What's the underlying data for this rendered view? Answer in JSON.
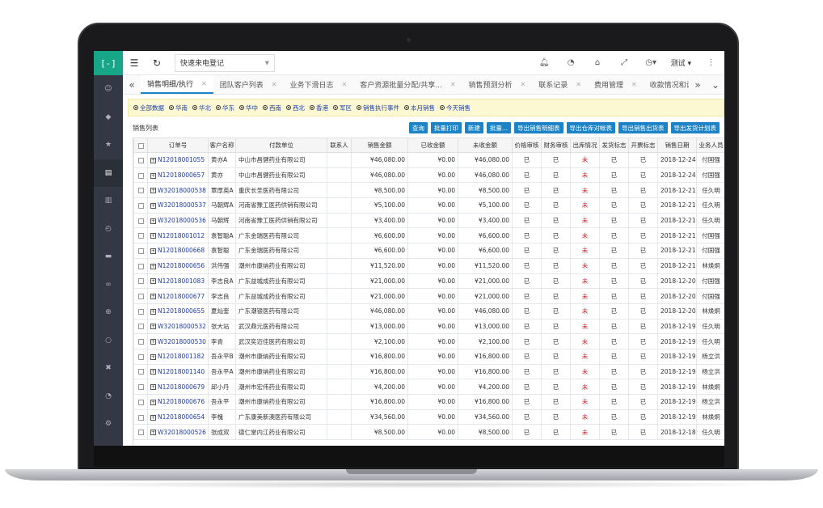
{
  "app": {
    "logo": "[-]",
    "quick_select": "快速来电登记",
    "user": "测试"
  },
  "sidebar": {
    "icons": [
      "user-icon",
      "cube-icon",
      "star-icon",
      "book-icon",
      "chart-icon",
      "clock-icon",
      "message-icon",
      "link-icon",
      "plus-circle-icon",
      "comment-icon",
      "wrench-icon",
      "gauge-icon",
      "settings-icon"
    ],
    "active_index": 3
  },
  "tabs": [
    {
      "label": "销售明细/执行",
      "active": true
    },
    {
      "label": "团队客户列表"
    },
    {
      "label": "业务下滑日志"
    },
    {
      "label": "客户资源批量分配/共享..."
    },
    {
      "label": "销售预测分析"
    },
    {
      "label": "联系记录"
    },
    {
      "label": "费用管理"
    },
    {
      "label": "收款情况和计划"
    }
  ],
  "filters": [
    "全部数据",
    "华南",
    "华北",
    "华东",
    "华中",
    "西南",
    "西北",
    "香港",
    "军区",
    "销售执行事件",
    "本月销售",
    "今天销售"
  ],
  "list_title": "销售列表",
  "actions": [
    "查询",
    "批量打印",
    "新建",
    "批量...",
    "导出销售明细表",
    "导出仓库对帐表",
    "导出销售出货表",
    "导出发货计划表"
  ],
  "columns": [
    "",
    "订单号",
    "客户名称",
    "付款单位",
    "联系人",
    "销售金额",
    "已收金额",
    "未收金额",
    "价格审核",
    "财务审核",
    "出库情况",
    "发货标志",
    "开票标志",
    "销售日期",
    "业务人员"
  ],
  "rows": [
    [
      "N12018001055",
      "黄亦A",
      "中山市昌健药业有限公司",
      "",
      "¥46,080.00",
      "¥0.00",
      "¥46,080.00",
      "已",
      "已",
      "未",
      "已",
      "已",
      "2018-12-24",
      "付国强"
    ],
    [
      "N12018000657",
      "黄亦",
      "中山市昌健药业有限公司",
      "",
      "¥46,080.00",
      "¥0.00",
      "¥46,080.00",
      "已",
      "已",
      "未",
      "已",
      "已",
      "2018-12-24",
      "付国强"
    ],
    [
      "W32018000538",
      "覃厚英A",
      "重庆长圣医药有限公司",
      "",
      "¥8,500.00",
      "¥0.00",
      "¥8,500.00",
      "已",
      "已",
      "未",
      "已",
      "已",
      "2018-12-21",
      "任久明"
    ],
    [
      "W32018000537",
      "马朝辉A",
      "河南省豫工医药供销有限公司",
      "",
      "¥5,100.00",
      "¥0.00",
      "¥5,100.00",
      "已",
      "已",
      "未",
      "已",
      "已",
      "2018-12-21",
      "任久明"
    ],
    [
      "W32018000536",
      "马朝辉",
      "河南省豫工医药供销有限公司",
      "",
      "¥3,400.00",
      "¥0.00",
      "¥3,400.00",
      "已",
      "已",
      "未",
      "已",
      "已",
      "2018-12-21",
      "任久明"
    ],
    [
      "N12018001012",
      "袁智聪A",
      "广东金瑞医药有限公司",
      "",
      "¥6,600.00",
      "¥0.00",
      "¥6,600.00",
      "已",
      "已",
      "未",
      "已",
      "已",
      "2018-12-21",
      "付国强"
    ],
    [
      "N12018000668",
      "袁智聪",
      "广东金瑞医药有限公司",
      "",
      "¥6,600.00",
      "¥0.00",
      "¥6,600.00",
      "已",
      "已",
      "未",
      "已",
      "已",
      "2018-12-21",
      "付国强"
    ],
    [
      "N12018000656",
      "洪伟强",
      "潮州市康纳药业有限公司",
      "",
      "¥11,520.00",
      "¥0.00",
      "¥11,520.00",
      "已",
      "已",
      "未",
      "已",
      "已",
      "2018-12-21",
      "林焕炯"
    ],
    [
      "N12018001083",
      "李志良A",
      "广东益城成药业有限公司",
      "",
      "¥21,000.00",
      "¥0.00",
      "¥21,000.00",
      "已",
      "已",
      "未",
      "已",
      "已",
      "2018-12-20",
      "付国强"
    ],
    [
      "N12018000677",
      "李志良",
      "广东益城成药业有限公司",
      "",
      "¥21,000.00",
      "¥0.00",
      "¥21,000.00",
      "已",
      "已",
      "未",
      "已",
      "已",
      "2018-12-20",
      "付国强"
    ],
    [
      "N12018000655",
      "夏灿奎",
      "广东潮银医药有限公司",
      "",
      "¥46,080.00",
      "¥0.00",
      "¥46,080.00",
      "已",
      "已",
      "未",
      "已",
      "已",
      "2018-12-20",
      "林焕炯"
    ],
    [
      "W32018000532",
      "张大站",
      "武汉鼎元医药有限公司",
      "",
      "¥13,000.00",
      "¥0.00",
      "¥13,000.00",
      "已",
      "已",
      "未",
      "已",
      "已",
      "2018-12-19",
      "任久明"
    ],
    [
      "W32018000530",
      "李青",
      "武汉奕迈佳医药有限公司",
      "",
      "¥2,100.00",
      "¥0.00",
      "¥2,100.00",
      "已",
      "已",
      "未",
      "已",
      "已",
      "2018-12-19",
      "任久明"
    ],
    [
      "N12018001182",
      "吾永平B",
      "潮州市康纳药业有限公司",
      "",
      "¥16,800.00",
      "¥0.00",
      "¥16,800.00",
      "已",
      "已",
      "未",
      "已",
      "已",
      "2018-12-19",
      "杨立洪"
    ],
    [
      "N12018001140",
      "吾永平A",
      "潮州市康纳药业有限公司",
      "",
      "¥16,800.00",
      "¥0.00",
      "¥16,800.00",
      "已",
      "已",
      "未",
      "已",
      "已",
      "2018-12-19",
      "杨立洪"
    ],
    [
      "N12018000679",
      "邱小丹",
      "潮州市宏伟药业有限公司",
      "",
      "¥4,200.00",
      "¥0.00",
      "¥4,200.00",
      "已",
      "已",
      "未",
      "已",
      "已",
      "2018-12-19",
      "林焕炯"
    ],
    [
      "N12018000676",
      "吾永平",
      "潮州市康纳药业有限公司",
      "",
      "¥16,800.00",
      "¥0.00",
      "¥16,800.00",
      "已",
      "已",
      "未",
      "已",
      "已",
      "2018-12-19",
      "杨立洪"
    ],
    [
      "N12018000654",
      "李槐",
      "广东康美新澳医药有限公司",
      "",
      "¥34,560.00",
      "¥0.00",
      "¥34,560.00",
      "已",
      "已",
      "未",
      "已",
      "已",
      "2018-12-19",
      "林焕炯"
    ],
    [
      "W32018000526",
      "张成双",
      "德仁堂内江药业有限公司",
      "",
      "¥8,500.00",
      "¥0.00",
      "¥8,500.00",
      "已",
      "已",
      "未",
      "已",
      "已",
      "2018-12-18",
      "任久明"
    ]
  ]
}
